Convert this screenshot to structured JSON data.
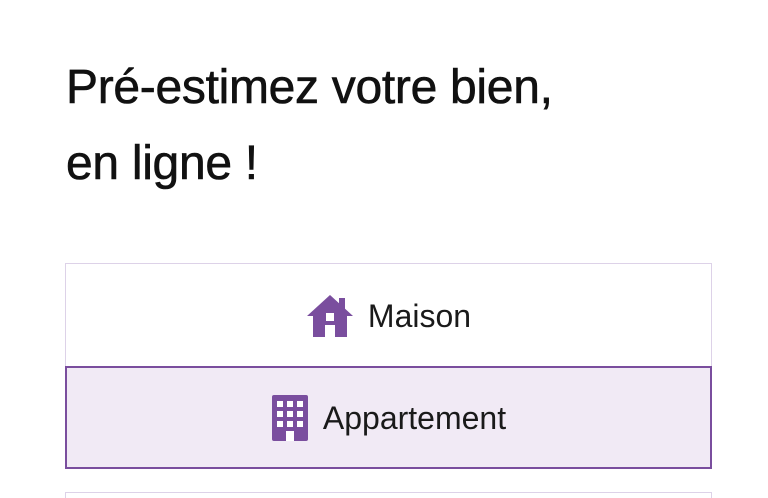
{
  "header": {
    "title_line1": "Pré-estimez votre bien,",
    "title_line2": "en ligne !"
  },
  "property_types": {
    "selected": "Appartement",
    "options": [
      {
        "label": "Maison",
        "icon": "house-icon"
      },
      {
        "label": "Appartement",
        "icon": "building-icon"
      }
    ]
  },
  "colors": {
    "accent": "#7a4e9e",
    "selected_background": "#f1eaf5",
    "border": "#ddd2e8",
    "text": "#111111"
  }
}
